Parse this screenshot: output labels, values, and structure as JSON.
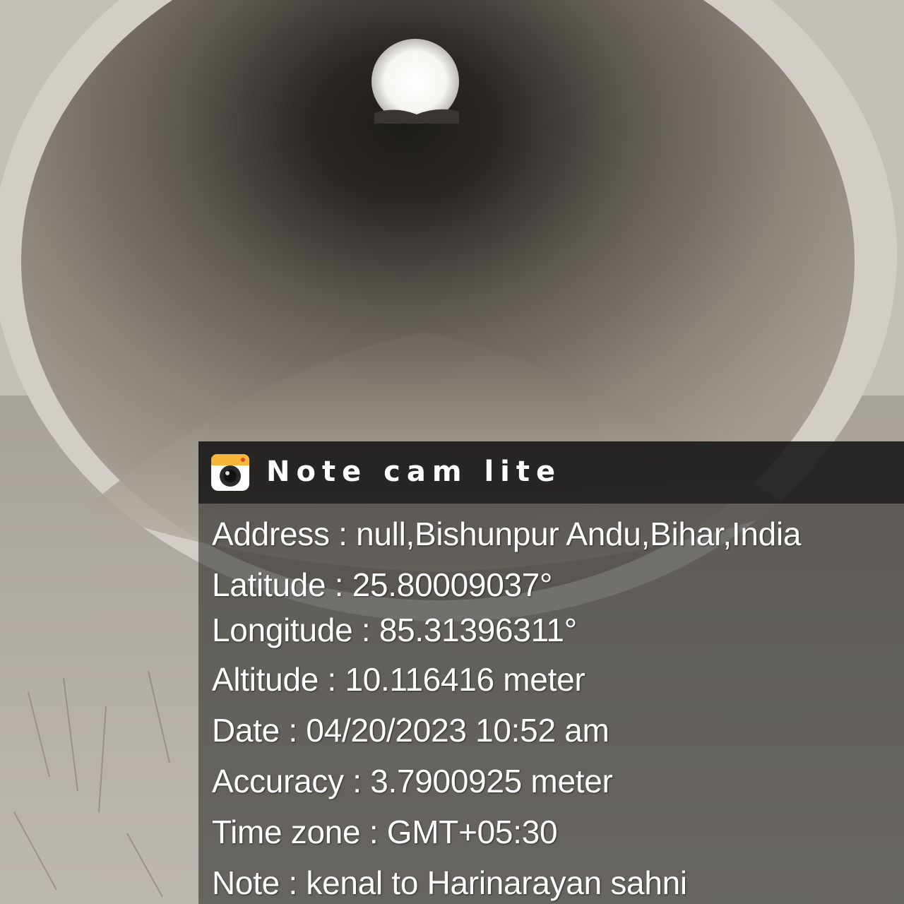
{
  "app": {
    "name": "Note cam lite",
    "icon": "camera-app-icon",
    "accent": "#f6b63a"
  },
  "fields": [
    {
      "key": "address",
      "text": "Address : null,Bishunpur Andu,Bihar,India"
    },
    {
      "key": "latitude",
      "text": "Latitude : 25.80009037°"
    },
    {
      "key": "longitude",
      "text": "Longitude : 85.31396311°"
    },
    {
      "key": "altitude",
      "text": "Altitude : 10.116416 meter"
    },
    {
      "key": "date",
      "text": "Date : 04/20/2023 10:52 am"
    },
    {
      "key": "accuracy",
      "text": "Accuracy : 3.7900925 meter"
    },
    {
      "key": "timezone",
      "text": "Time zone : GMT+05:30"
    },
    {
      "key": "note",
      "text": "Note : kenal to Harinarayan sahni"
    }
  ]
}
